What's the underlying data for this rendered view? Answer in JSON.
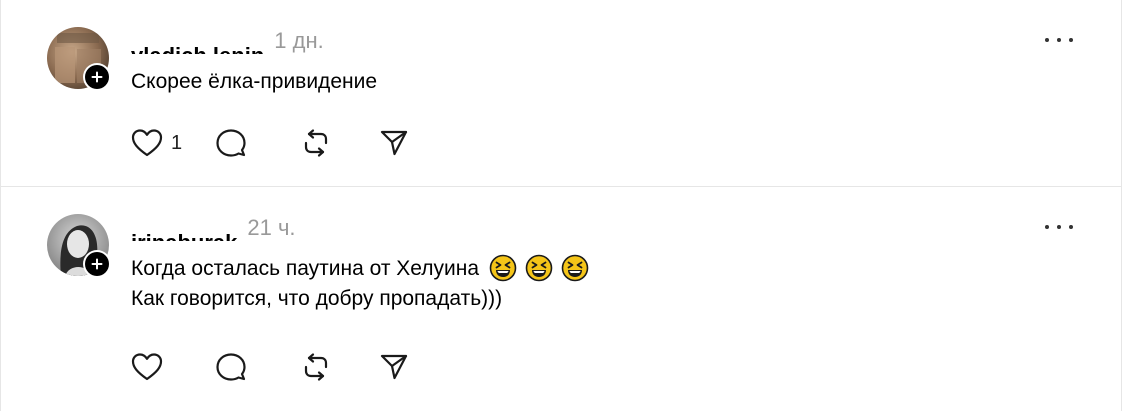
{
  "posts": [
    {
      "username": "vladich.lenin",
      "time": "1 дн.",
      "text_lines": [
        "Скорее ёлка-привидение"
      ],
      "emojis": [],
      "like_count": "1"
    },
    {
      "username": "irinaburak",
      "time": "21 ч.",
      "text_lines": [
        "Когда осталась паутина от Хелуина",
        "Как говорится, что добру пропадать)))"
      ],
      "emojis": [
        "😆",
        "😆",
        "😆"
      ],
      "like_count": ""
    }
  ],
  "icons": {
    "follow": "plus-icon",
    "more": "more-horizontal-icon",
    "like": "heart-icon",
    "comment": "comment-bubble-icon",
    "repost": "repost-icon",
    "share": "send-icon",
    "emoji": "grinning-squinting-face-icon"
  },
  "colors": {
    "text": "#000000",
    "muted": "#999999",
    "divider": "#e6e6e6",
    "emoji_face": "#f5c518"
  }
}
